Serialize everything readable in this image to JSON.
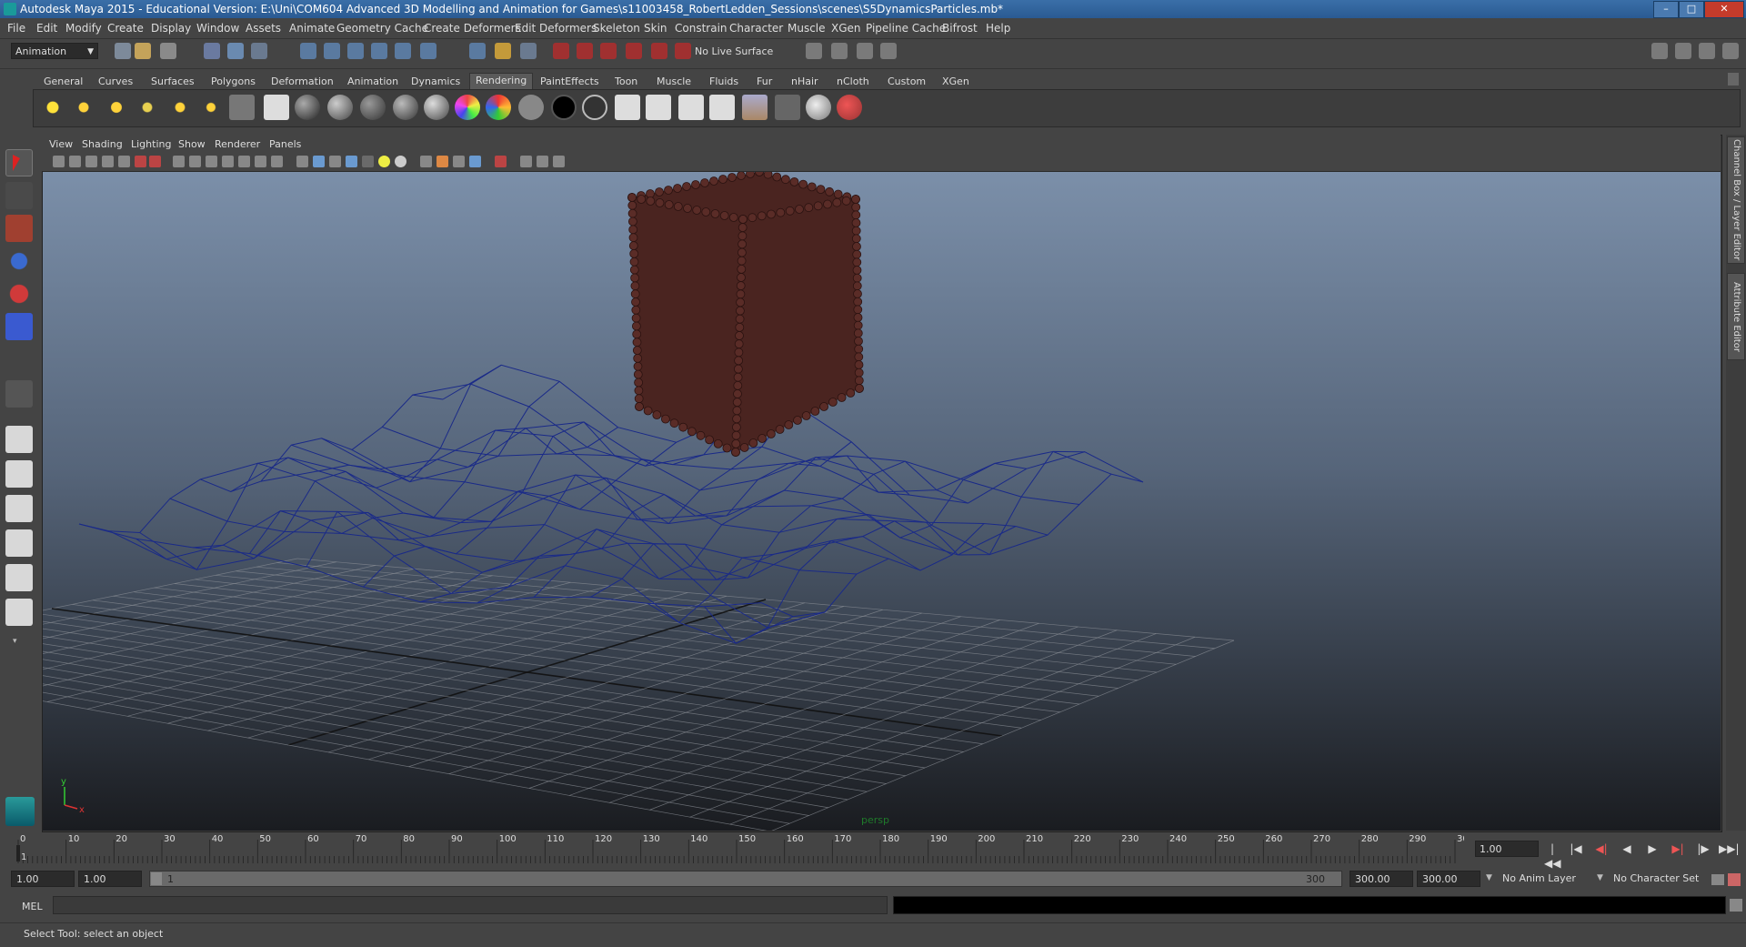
{
  "window": {
    "title": "Autodesk Maya 2015 - Educational Version: E:\\Uni\\COM604 Advanced 3D Modelling and Animation for Games\\s11003458_RobertLedden_Sessions\\scenes\\S5DynamicsParticles.mb*",
    "minimize_glyph": "–",
    "maximize_glyph": "□",
    "close_glyph": "✕"
  },
  "menubar": [
    "File",
    "Edit",
    "Modify",
    "Create",
    "Display",
    "Window",
    "Assets",
    "Animate",
    "Geometry Cache",
    "Create Deformers",
    "Edit Deformers",
    "Skeleton",
    "Skin",
    "Constrain",
    "Character",
    "Muscle",
    "XGen",
    "Pipeline Cache",
    "Bifrost",
    "Help"
  ],
  "statusline": {
    "mode": "Animation",
    "live_surface": "No Live Surface"
  },
  "shelf": {
    "tabs": [
      "General",
      "Curves",
      "Surfaces",
      "Polygons",
      "Deformation",
      "Animation",
      "Dynamics",
      "Rendering",
      "PaintEffects",
      "Toon",
      "Muscle",
      "Fluids",
      "Fur",
      "nHair",
      "nCloth",
      "Custom",
      "XGen"
    ],
    "active_tab": "Rendering"
  },
  "viewport": {
    "panel_menu": [
      "View",
      "Shading",
      "Lighting",
      "Show",
      "Renderer",
      "Panels"
    ],
    "camera_label": "persp",
    "axis_x": "x",
    "axis_y": "y",
    "particle_color": "#4a2420",
    "wire_color": "#1a2a88"
  },
  "side_tabs": {
    "channel_box": "Channel Box / Layer Editor",
    "attribute_editor": "Attribute Editor"
  },
  "timeline": {
    "ticks": [
      "0",
      "10",
      "20",
      "30",
      "40",
      "50",
      "60",
      "70",
      "80",
      "90",
      "100",
      "110",
      "120",
      "130",
      "140",
      "150",
      "160",
      "170",
      "180",
      "190",
      "200",
      "210",
      "220",
      "230",
      "240",
      "250",
      "260",
      "270",
      "280",
      "290",
      "30"
    ],
    "current_frame_marker": "1",
    "current_frame": "1.00",
    "playback": [
      "|◀◀",
      "|◀",
      "◀|",
      "◀",
      "▶",
      "▶|",
      "|▶",
      "▶▶|"
    ]
  },
  "range": {
    "start_time": "1.00",
    "playback_start": "1.00",
    "range_start_label": "1",
    "range_end_label": "300",
    "playback_end": "300.00",
    "end_time": "300.00",
    "anim_layer": "No Anim Layer",
    "character_set": "No Character Set"
  },
  "command_line": {
    "label": "MEL"
  },
  "help_line": {
    "text": "Select Tool: select an object"
  }
}
